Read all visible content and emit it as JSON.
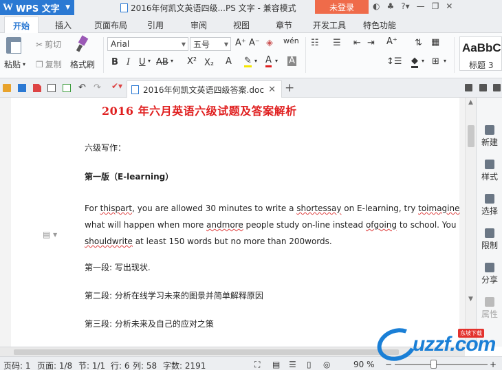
{
  "titlebar": {
    "app_name": "WPS 文字",
    "title": "2016年何凯文英语四级...PS 文字 - 兼容模式",
    "login": "未登录"
  },
  "menu": {
    "tabs": [
      "开始",
      "插入",
      "页面布局",
      "引用",
      "审阅",
      "视图",
      "章节",
      "开发工具",
      "特色功能"
    ]
  },
  "ribbon": {
    "paste": "粘贴",
    "cut": "剪切",
    "copy": "复制",
    "format_painter": "格式刷",
    "font_name": "Arial",
    "font_size": "五号",
    "style_preview": "AaBbC",
    "style_name": "标题 3"
  },
  "doctab": {
    "name": "2016年何凯文英语四级答案.doc"
  },
  "document": {
    "title": "2016 年六月英语六级试题及答案解析",
    "section_label": "六级写作：",
    "version": "第一版（E-learning）",
    "body": {
      "l1_a": "For ",
      "l1_b": "thispart",
      "l1_c": ", you are allowed 30 minutes to write a ",
      "l1_d": "shortessay",
      "l1_e": " on E-learning, try ",
      "l1_f": "toimagine",
      "l2_a": "what will happen when more ",
      "l2_b": "andmore",
      "l2_c": " people study on-line instead ",
      "l2_d": "ofgoing",
      "l2_e": " to school. You",
      "l3_a": "shouldwrite",
      "l3_b": " at least 150 words but no more than 200words."
    },
    "p1": "第一段: 写出现状.",
    "p2": "第二段: 分析在线学习未来的图景并简单解释原因",
    "p3": "第三段: 分析未来及自己的应对之策"
  },
  "rpanel": {
    "items": [
      "新建",
      "样式",
      "选择",
      "限制",
      "分享",
      "属性"
    ]
  },
  "status": {
    "page_code": "页码: 1",
    "page": "页面: 1/8",
    "section": "节: 1/1",
    "row": "行: 6",
    "col": "列: 58",
    "words": "字数: 2191",
    "zoom": "90 %"
  },
  "watermark": {
    "text": "uzzf.com",
    "tag": "东坡下载"
  }
}
